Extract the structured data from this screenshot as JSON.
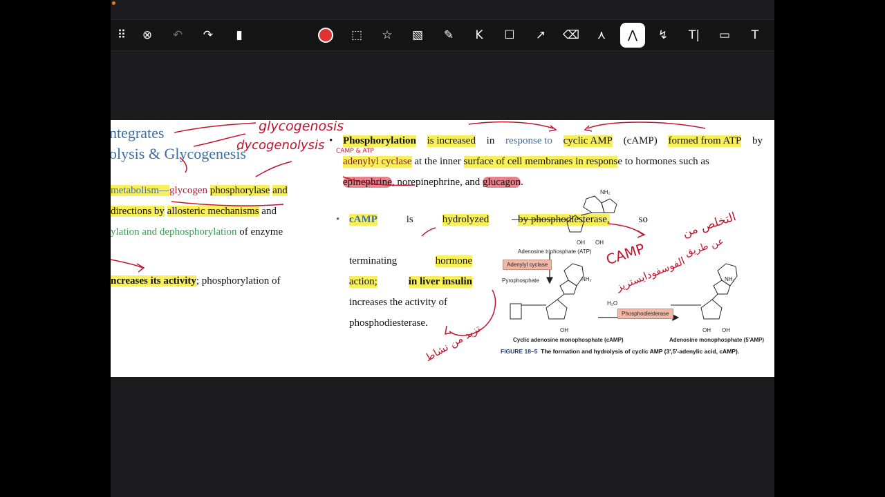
{
  "toolbar": {
    "tools": [
      {
        "name": "more-handle-icon",
        "glyph": "⠿"
      },
      {
        "name": "close-icon",
        "glyph": "⊗"
      },
      {
        "name": "undo-icon",
        "glyph": "↶"
      },
      {
        "name": "redo-icon",
        "glyph": "↷"
      },
      {
        "name": "highlighter-icon",
        "glyph": "▮"
      },
      {
        "name": "record-icon",
        "glyph": ""
      },
      {
        "name": "selection-icon",
        "glyph": "⬚"
      },
      {
        "name": "star-icon",
        "glyph": "☆"
      },
      {
        "name": "image-icon",
        "glyph": "▧"
      },
      {
        "name": "pen-p-icon",
        "glyph": "✎"
      },
      {
        "name": "k-p-icon",
        "glyph": "K"
      },
      {
        "name": "shape-icon",
        "glyph": "☐"
      },
      {
        "name": "line-icon",
        "glyph": "↗"
      },
      {
        "name": "eraser-icon",
        "glyph": "⌫"
      },
      {
        "name": "laser-pointer-icon",
        "glyph": "⋏"
      },
      {
        "name": "pen-active-icon",
        "glyph": "⋀"
      },
      {
        "name": "shape-recognition-icon",
        "glyph": "↯"
      },
      {
        "name": "text-cursor-icon",
        "glyph": "T|"
      },
      {
        "name": "comment-icon",
        "glyph": "▭"
      },
      {
        "name": "text-box-icon",
        "glyph": "T"
      }
    ]
  },
  "left_column": {
    "heading_line1": "ntegrates",
    "heading_line2": "olysis & Glycogenesis",
    "line1_a": "metabolism—",
    "line1_b": "glycogen",
    "line1_c": "phosphorylase",
    "line1_d": "and",
    "line2_a": "directions by",
    "line2_b": "allosteric mechanisms",
    "line2_c": "and",
    "line3_a": "ylation and dephosphorylation",
    "line3_b": "of enzyme",
    "line4_a": "ncreases its activity",
    "line4_b": "; phosphorylation of"
  },
  "right_column": {
    "bullet": "•",
    "p1_w1": "Phosphorylation",
    "p1_w2": "is increased",
    "p1_w3": "in",
    "p1_w4": "response to",
    "p1_w5": "cyclic AMP",
    "p1_w6": "(cAMP)",
    "p1_w7": "formed from ATP",
    "p1_w8": "by",
    "p1_l2a": "adenylyl cyclase",
    "p1_l2b": "at the inner",
    "p1_l2c": "surface of cell membranes in respons",
    "p1_l2d": "e to hormones such as",
    "p1_l3a": "epinephrine",
    "p1_l3b": ", norepinephrine, and",
    "p1_l3c": "glucagon",
    "p1_l3d": ".",
    "p2_bullet": "•",
    "p2_w1": "cAMP",
    "p2_w2": "is",
    "p2_w3": "hydrolyzed",
    "p2_w4": "by phosphodiesterase,",
    "p2_w5": "so",
    "p2_l2a": "terminating",
    "p2_l2b": "hormone",
    "p2_l3a": "action;",
    "p2_l3b": "in liver insulin",
    "p2_l4": "increases the activity of",
    "p2_l5": "phosphodiesterase."
  },
  "figure": {
    "atp_label": "Adenosine triphosphate (ATP)",
    "adenylyl_box": "Adenylyl cyclase",
    "pyrophosphate": "Pyrophosphate",
    "camp_label": "Cyclic adenosine monophosphate (cAMP)",
    "pde_box": "Phosphodiesterase",
    "amp_label": "Adenosine monophosphate (5′AMP)",
    "h2o": "H₂O",
    "nh2": "NH₂",
    "oh": "OH",
    "caption_bold": "FIGURE 18–5",
    "caption_text": "The formation and hydrolysis of cyclic AMP (3′,5′-adenylic acid, cAMP)."
  },
  "annotations": {
    "glycogenosis": "glycogenosis",
    "glycogenolysis": "dycogenolysis",
    "arabic_top": "CAMP & ATP",
    "arabic_right_1": "التخلص من",
    "arabic_right_2": "CAMP",
    "arabic_right_3": "عن طريق",
    "arabic_right_4": "الفوسفودايستريز",
    "arabic_bottom": "تزيد من نشاط"
  },
  "colors": {
    "highlight_yellow": "#f7ef5c",
    "highlight_red": "#e6848e",
    "ink_red": "#c0142d",
    "link_blue": "#3d6ea5",
    "green": "#2fa14b"
  }
}
